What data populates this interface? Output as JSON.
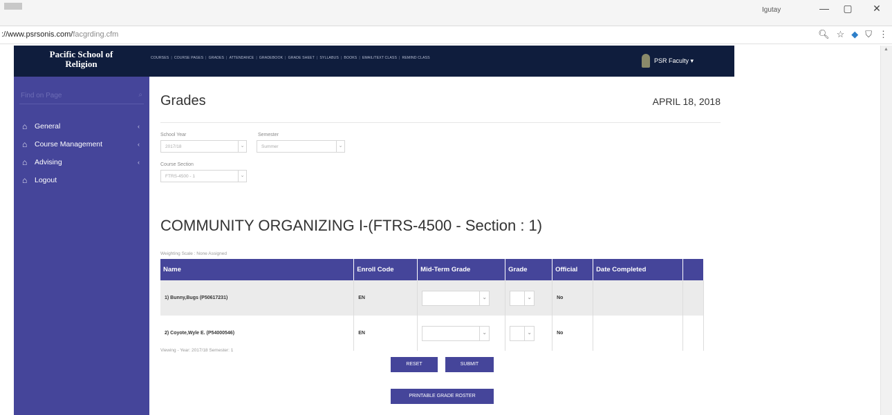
{
  "browser": {
    "user": "Igutay",
    "minimize": "—",
    "restore": "▢",
    "close": "✕",
    "url_host": "://www.psrsonis.com/",
    "url_path": "facgrding.cfm"
  },
  "brand": {
    "line1": "Pacific School of",
    "line2": "Religion"
  },
  "topnav": [
    "COURSES",
    "COURSE PAGES",
    "GRADES",
    "ATTENDANCE",
    "GRADEBOOK",
    "GRADE SHEET",
    "SYLLABUS",
    "BOOKS",
    "EMAIL/TEXT CLASS",
    "REMIND CLASS"
  ],
  "user_menu": {
    "label": "PSR Faculty ▾"
  },
  "sidebar": {
    "search_placeholder": "Find on Page",
    "items": [
      {
        "label": "General",
        "has_children": true
      },
      {
        "label": "Course Management",
        "has_children": true
      },
      {
        "label": "Advising",
        "has_children": true
      },
      {
        "label": "Logout",
        "has_children": false
      }
    ]
  },
  "main": {
    "title": "Grades",
    "date": "APRIL 18, 2018",
    "filters": {
      "school_year_label": "School Year",
      "school_year_value": "2017/18",
      "semester_label": "Semester",
      "semester_value": "Summer",
      "course_section_label": "Course Section",
      "course_section_value": "FTRS-4500 - 1"
    },
    "course_title": "COMMUNITY ORGANIZING I-(FTRS-4500 - Section : 1)",
    "weighting_scale": "Weighting Scale : None Assigned",
    "table": {
      "headers": [
        "Name",
        "Enroll Code",
        "Mid-Term Grade",
        "Grade",
        "Official",
        "Date Completed",
        ""
      ],
      "rows": [
        {
          "name": "1) Bunny,Bugs (P50617231)",
          "enroll_code": "EN",
          "official": "No",
          "date_completed": ""
        },
        {
          "name": "2) Coyote,Wyle E. (P54000546)",
          "enroll_code": "EN",
          "official": "No",
          "date_completed": ""
        }
      ]
    },
    "viewing": "Viewing - Year: 2017/18 Semester: 1",
    "buttons": {
      "reset": "RESET",
      "submit": "SUBMIT",
      "roster": "PRINTABLE GRADE ROSTER"
    }
  },
  "colors": {
    "navy": "#0f1d3d",
    "purple": "#45459a",
    "row_alt": "#ebebeb"
  }
}
